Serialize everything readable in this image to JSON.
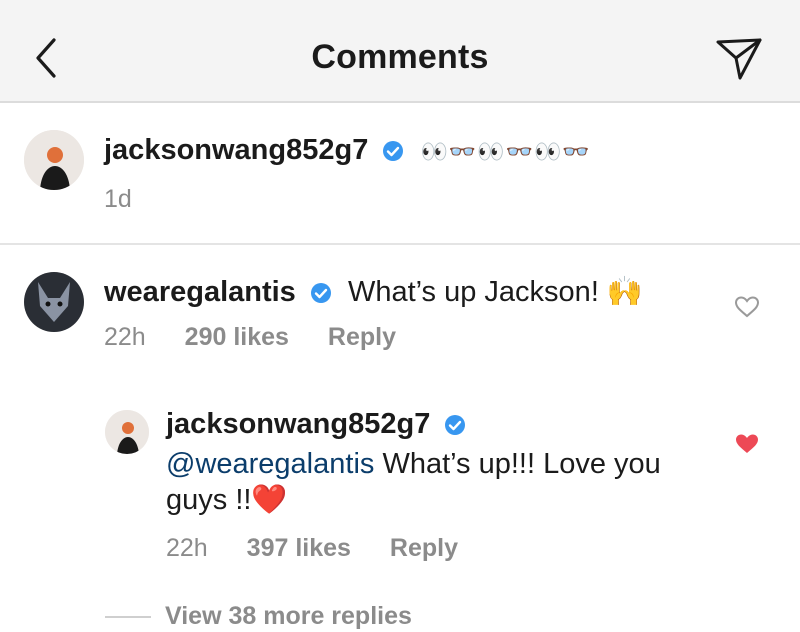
{
  "header": {
    "title": "Comments",
    "back_icon": "chevron-left-icon",
    "send_icon": "paper-plane-icon"
  },
  "caption": {
    "username": "jacksonwang852g7",
    "verified": true,
    "emoji_sequence": "👀👓👀👓👀👓",
    "time": "1d"
  },
  "comment": {
    "username": "wearegalantis",
    "verified": true,
    "text": "What’s up Jackson! 🙌",
    "time": "22h",
    "likes": "290 likes",
    "reply_label": "Reply",
    "liked": false
  },
  "reply": {
    "username": "jacksonwang852g7",
    "verified": true,
    "mention": "@wearegalantis",
    "text": " What’s up!!! Love you guys !!❤️",
    "time": "22h",
    "likes": "397 likes",
    "reply_label": "Reply",
    "liked": true
  },
  "view_more": "View 38 more replies",
  "colors": {
    "verified_blue": "#3897f0",
    "liked_red": "#ed4956",
    "meta_gray": "#8b8b8b",
    "header_bg": "#f4f4f4"
  }
}
